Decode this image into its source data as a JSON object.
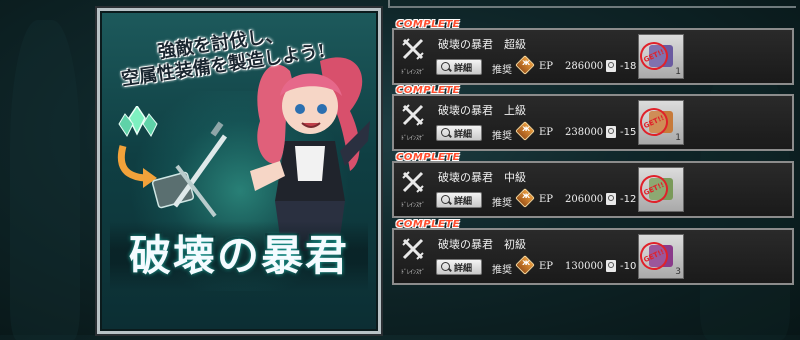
{
  "banner": {
    "subtitle": "強敵を討伐し、\n空属性装備を製造しよう!",
    "title": "破壊の暴君"
  },
  "quests": [
    {
      "status": "COMPLETE",
      "title": "破壊の暴君　超級",
      "icon_code": "ﾄﾞﾚｲﾝｽｹﾞ",
      "detail": "詳細",
      "recommended": "推奨",
      "ep_label": "EP",
      "ep": "286000",
      "boost": "-18",
      "reward_qty": "1",
      "stamp": "GET!!",
      "reward_color": "#6a5aa0"
    },
    {
      "status": "COMPLETE",
      "title": "破壊の暴君　上級",
      "icon_code": "ﾄﾞﾚｲﾝｽｹﾞ",
      "detail": "詳細",
      "recommended": "推奨",
      "ep_label": "EP",
      "ep": "238000",
      "boost": "-15",
      "reward_qty": "1",
      "stamp": "GET!!",
      "reward_color": "#c77a3a"
    },
    {
      "status": "COMPLETE",
      "title": "破壊の暴君　中級",
      "icon_code": "ﾄﾞﾚｲﾝｽｹﾞ",
      "detail": "詳細",
      "recommended": "推奨",
      "ep_label": "EP",
      "ep": "206000",
      "boost": "-12",
      "reward_qty": "",
      "stamp": "GET!!",
      "reward_color": "#7a9a5a"
    },
    {
      "status": "COMPLETE",
      "title": "破壊の暴君　初級",
      "icon_code": "ﾄﾞﾚｲﾝｽｹﾞ",
      "detail": "詳細",
      "recommended": "推奨",
      "ep_label": "EP",
      "ep": "130000",
      "boost": "-10",
      "reward_qty": "3",
      "stamp": "GET!!",
      "reward_color": "#8a3a8a"
    }
  ]
}
